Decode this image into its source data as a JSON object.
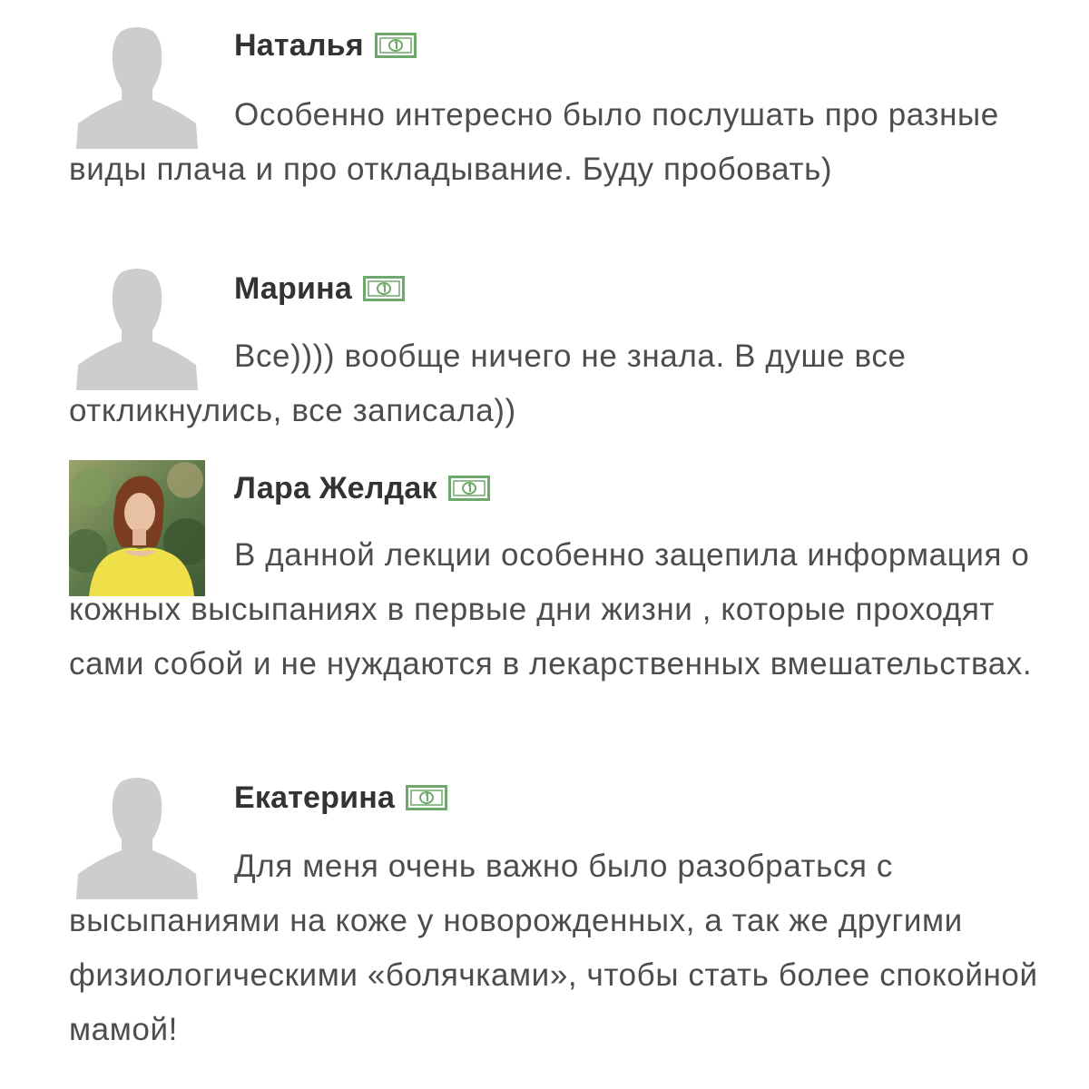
{
  "comments": [
    {
      "author": "Наталья",
      "avatar": "default-user-avatar",
      "badge_icon": "money-bill-icon",
      "text": "Особенно интересно было послушать про разные виды плача и про откладывание. Буду пробовать)"
    },
    {
      "author": "Марина",
      "avatar": "default-user-avatar",
      "badge_icon": "money-bill-icon",
      "text": "Все)))) вообще ничего не знала. В душе все откликнулись, все записала))"
    },
    {
      "author": "Лара Желдак",
      "avatar": "user-photo",
      "badge_icon": "money-bill-icon",
      "text": "В данной лекции особенно зацепила информация о кожных высыпаниях в первые дни жизни , которые проходят сами собой и не нуждаются в лекарственных вмешательствах."
    },
    {
      "author": "Екатерина",
      "avatar": "default-user-avatar",
      "badge_icon": "money-bill-icon",
      "text": "Для меня очень важно было разобраться с высыпаниями на коже у новорожденных, а так же другими физиологическими «болячками», чтобы стать более спокойной мамой!"
    }
  ],
  "colors": {
    "avatar_placeholder": "#cdcdcd",
    "badge_green": "#6fa86b",
    "author_text": "#333333",
    "body_text": "#4d4d4d"
  }
}
